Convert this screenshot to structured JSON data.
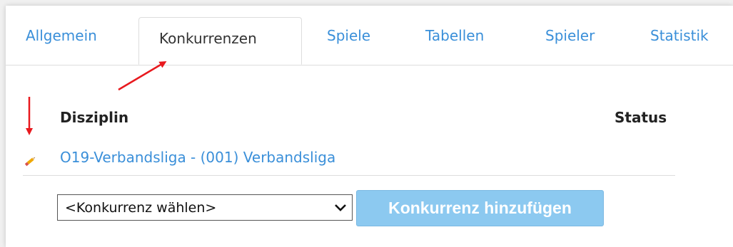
{
  "tabs": [
    {
      "label": "Allgemein"
    },
    {
      "label": "Konkurrenzen",
      "active": true
    },
    {
      "label": "Spiele"
    },
    {
      "label": "Tabellen"
    },
    {
      "label": "Spieler"
    },
    {
      "label": "Statistik"
    }
  ],
  "table": {
    "headers": {
      "disziplin": "Disziplin",
      "status": "Status"
    },
    "rows": [
      {
        "disziplin": "O19-Verbandsliga - (001) Verbandsliga",
        "edit_icon": "pencil-icon"
      }
    ]
  },
  "add_form": {
    "select_value": "<Konkurrenz wählen>",
    "button_label": "Konkurrenz hinzufügen"
  },
  "colors": {
    "link": "#3a8fd9",
    "button_bg": "#8cc9f0",
    "annotation_arrow": "#e8191e",
    "pencil": "#f0a800"
  }
}
